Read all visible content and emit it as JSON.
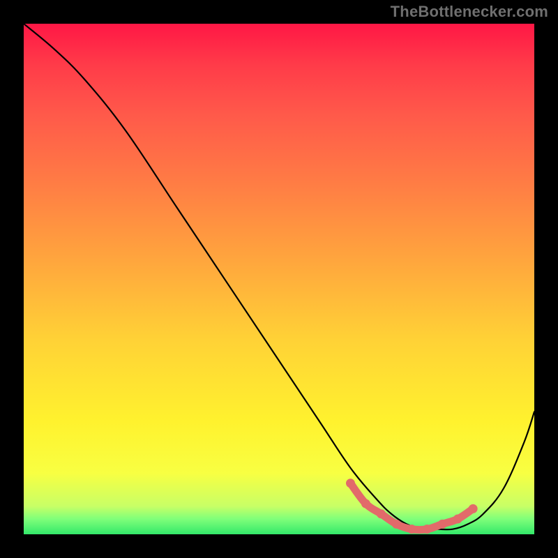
{
  "watermark": "TheBottlenecker.com",
  "chart_data": {
    "type": "line",
    "title": "",
    "xlabel": "",
    "ylabel": "",
    "xlim": [
      0,
      100
    ],
    "ylim": [
      0,
      100
    ],
    "series": [
      {
        "name": "bottleneck-curve",
        "x": [
          0,
          6,
          12,
          20,
          30,
          40,
          50,
          58,
          64,
          69,
          72,
          75,
          78,
          81,
          84,
          87,
          90,
          94,
          98,
          100
        ],
        "y": [
          100,
          95,
          89,
          79,
          64,
          49,
          34,
          22,
          13,
          7,
          4,
          2,
          1,
          1,
          1,
          2,
          4,
          9,
          18,
          24
        ]
      }
    ],
    "highlight_segment": {
      "name": "optimal-range",
      "x": [
        64,
        67,
        70,
        73,
        76,
        79,
        82,
        85,
        88
      ],
      "y": [
        10,
        6,
        4,
        2,
        1,
        1,
        2,
        3,
        5
      ]
    },
    "gradient_stops": [
      {
        "pos": 0.0,
        "color": "#ff1745"
      },
      {
        "pos": 0.08,
        "color": "#ff3b49"
      },
      {
        "pos": 0.18,
        "color": "#ff5a4a"
      },
      {
        "pos": 0.3,
        "color": "#ff7945"
      },
      {
        "pos": 0.45,
        "color": "#ffa23e"
      },
      {
        "pos": 0.62,
        "color": "#ffd236"
      },
      {
        "pos": 0.78,
        "color": "#fff22e"
      },
      {
        "pos": 0.88,
        "color": "#f8ff42"
      },
      {
        "pos": 0.945,
        "color": "#c8ff66"
      },
      {
        "pos": 0.97,
        "color": "#7fff7a"
      },
      {
        "pos": 1.0,
        "color": "#33e86a"
      }
    ]
  }
}
